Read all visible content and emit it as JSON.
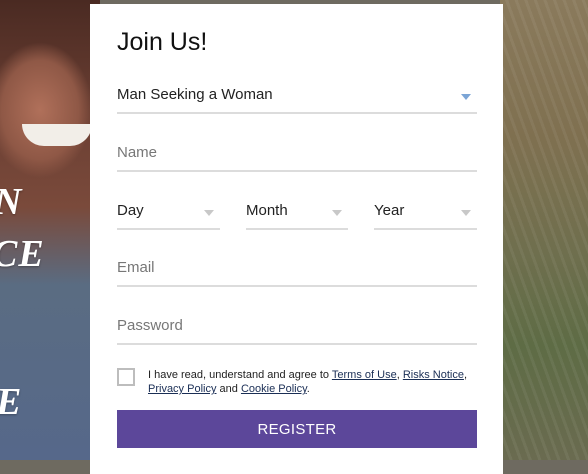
{
  "background": {
    "text_lines": [
      "N",
      "CE",
      "E"
    ]
  },
  "form": {
    "title": "Join Us!",
    "seeking": {
      "value": "Man Seeking a Woman"
    },
    "name": {
      "placeholder": "Name"
    },
    "dob": {
      "day": "Day",
      "month": "Month",
      "year": "Year"
    },
    "email": {
      "placeholder": "Email"
    },
    "password": {
      "placeholder": "Password"
    },
    "agreement": {
      "prefix": "I have read, understand and agree to",
      "terms": "Terms of Use",
      "sep1": ",",
      "risks": "Risks Notice",
      "sep2": ",",
      "privacy": "Privacy Policy",
      "and": "and",
      "cookie": "Cookie Policy",
      "end": "."
    },
    "register_label": "REGISTER"
  },
  "colors": {
    "button": "#5c479a",
    "link": "#1a2e55",
    "underline": "#dcdcdc"
  }
}
